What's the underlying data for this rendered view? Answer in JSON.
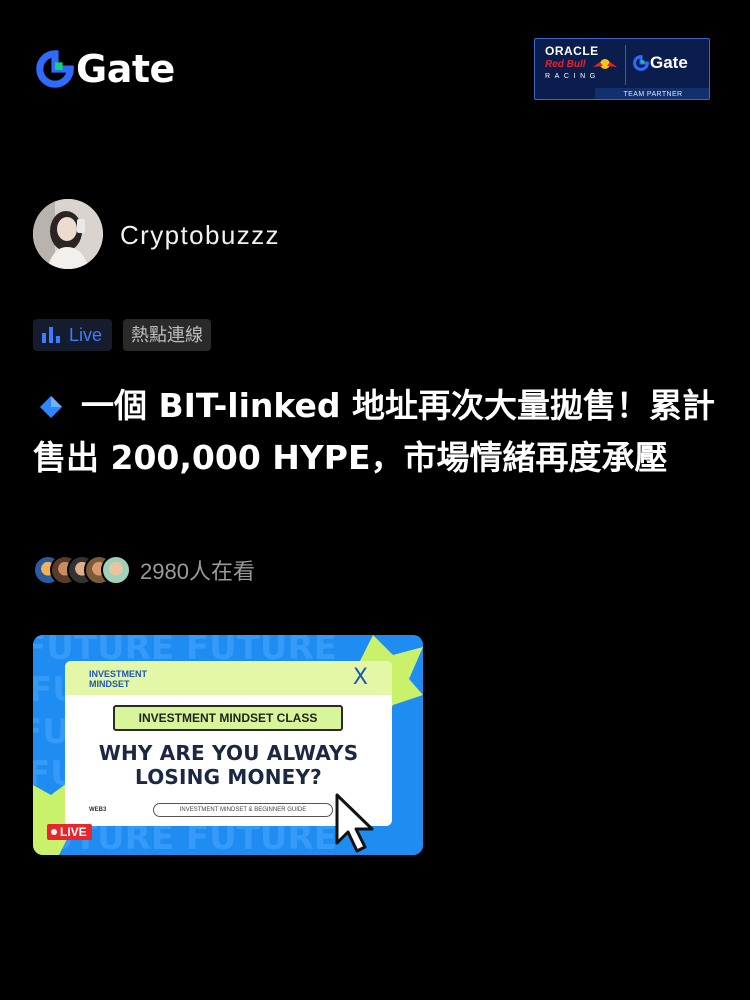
{
  "header": {
    "brand": "Gate",
    "partner": {
      "oracle": "ORACLE",
      "redbull": "Red Bull",
      "racing": "RACING",
      "gate": "Gate",
      "team_partner": "TEAM PARTNER"
    }
  },
  "post": {
    "author": "Cryptobuzzz",
    "tags": {
      "live": "Live",
      "hot": "熱點連線"
    },
    "headline": "一個 BIT-linked 地址再次大量拋售！累計售出 200,000 HYPE，市場情緒再度承壓",
    "viewers": "2980人在看"
  },
  "video": {
    "investment_tag_line1": "INVESTMENT",
    "investment_tag_line2": "MINDSET",
    "close": "X",
    "class_label": "INVESTMENT MINDSET CLASS",
    "question_line1": "WHY ARE YOU ALWAYS",
    "question_line2": "LOSING MONEY?",
    "guide": "INVESTMENT MINDSET & BEGINNER GUIDE",
    "web3": "WEB3",
    "live_badge": "LIVE"
  },
  "colors": {
    "background": "#000000",
    "accent_blue": "#3d7cff",
    "gate_green": "#16d36e",
    "live_red": "#e8262e"
  }
}
